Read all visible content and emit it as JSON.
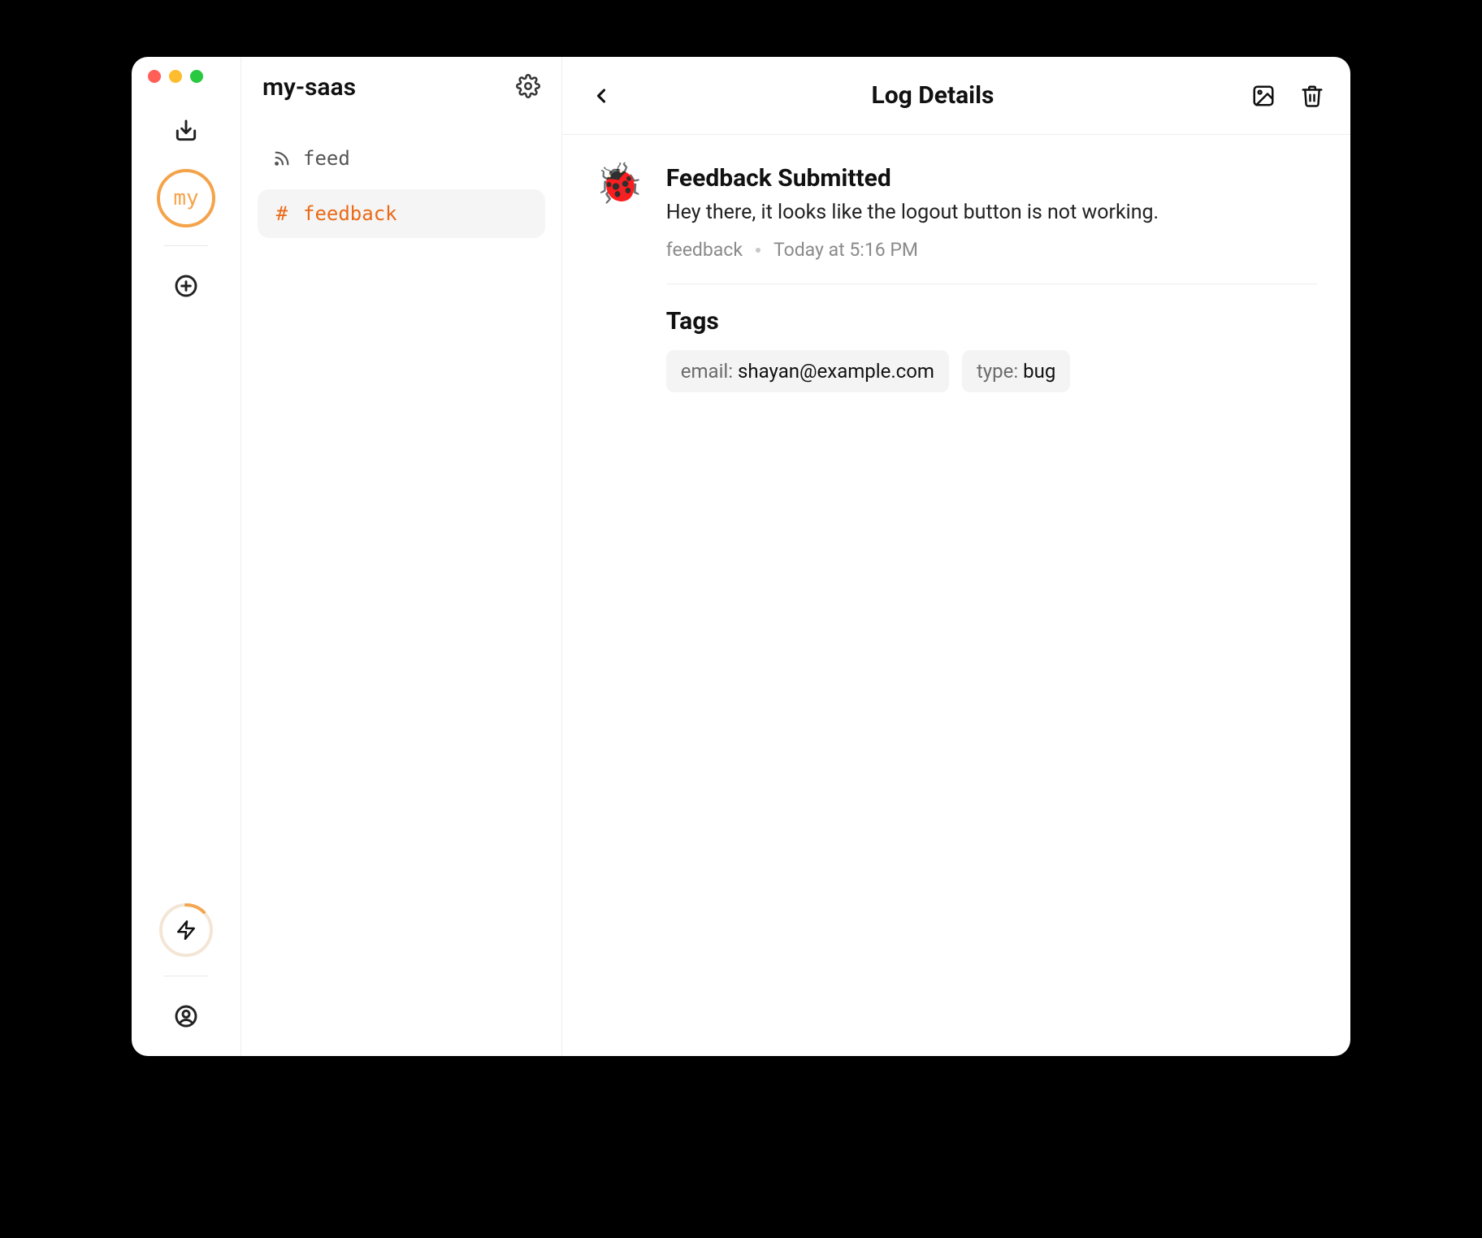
{
  "rail": {
    "avatar_label": "my"
  },
  "sidebar": {
    "project": "my-saas",
    "channels": [
      {
        "symbol": "rss",
        "label": "feed",
        "active": false
      },
      {
        "symbol": "#",
        "label": "feedback",
        "active": true
      }
    ]
  },
  "detail": {
    "header_title": "Log Details",
    "icon": "🐞",
    "title": "Feedback Submitted",
    "message": "Hey there, it looks like the logout button is not working.",
    "channel": "feedback",
    "timestamp": "Today at 5:16 PM",
    "tags_title": "Tags",
    "tags": [
      {
        "key": "email",
        "value": "shayan@example.com"
      },
      {
        "key": "type",
        "value": "bug"
      }
    ]
  }
}
